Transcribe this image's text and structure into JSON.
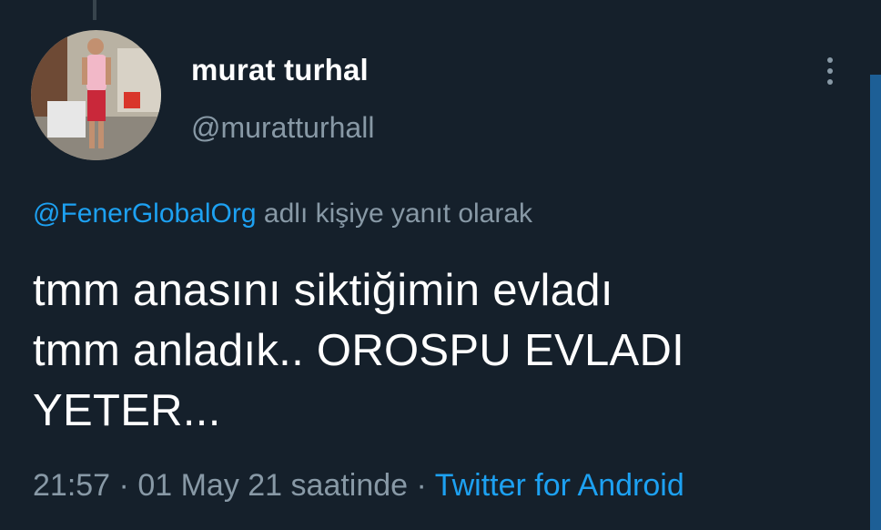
{
  "tweet": {
    "display_name": "murat turhal",
    "handle": "@muratturhall",
    "reply_to": {
      "mention": "@FenerGlobalOrg",
      "suffix": "adlı kişiye yanıt olarak"
    },
    "text_lines": [
      "tmm anasını siktiğimin evladı",
      "tmm anladık.. OROSPU EVLADI",
      "YETER..."
    ],
    "time": "21:57",
    "separator": "·",
    "date": "01 May 21 saatinde",
    "source": "Twitter for Android"
  },
  "icons": {
    "more": "more-vertical-icon",
    "avatar": "user-avatar"
  },
  "colors": {
    "background": "#15202b",
    "primary_text": "#ffffff",
    "secondary_text": "#8899a6",
    "accent": "#1da1f2"
  }
}
